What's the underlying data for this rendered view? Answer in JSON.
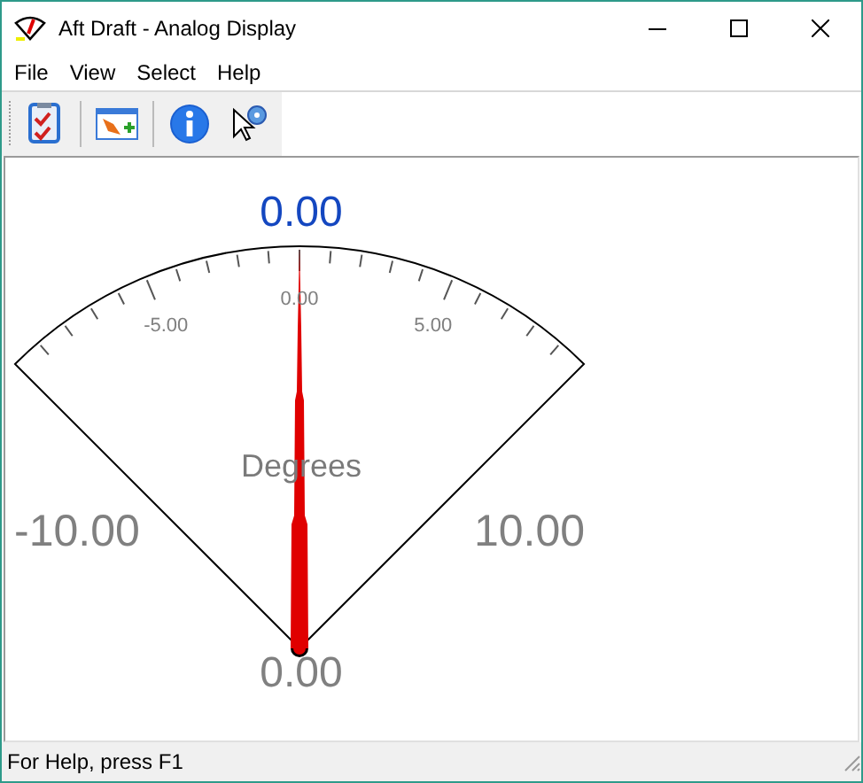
{
  "window": {
    "title": "Aft Draft - Analog Display"
  },
  "menu": [
    {
      "label": "File"
    },
    {
      "label": "View"
    },
    {
      "label": "Select"
    },
    {
      "label": "Help"
    }
  ],
  "gauge": {
    "reading": "0.00",
    "unit": "Degrees",
    "min_label": "-10.00",
    "max_label": "10.00",
    "scale_labels": [
      "-5.00",
      "0.00",
      "5.00"
    ],
    "value_label": "0.00",
    "level": 0.5
  },
  "status_bar": "For Help, press F1"
}
